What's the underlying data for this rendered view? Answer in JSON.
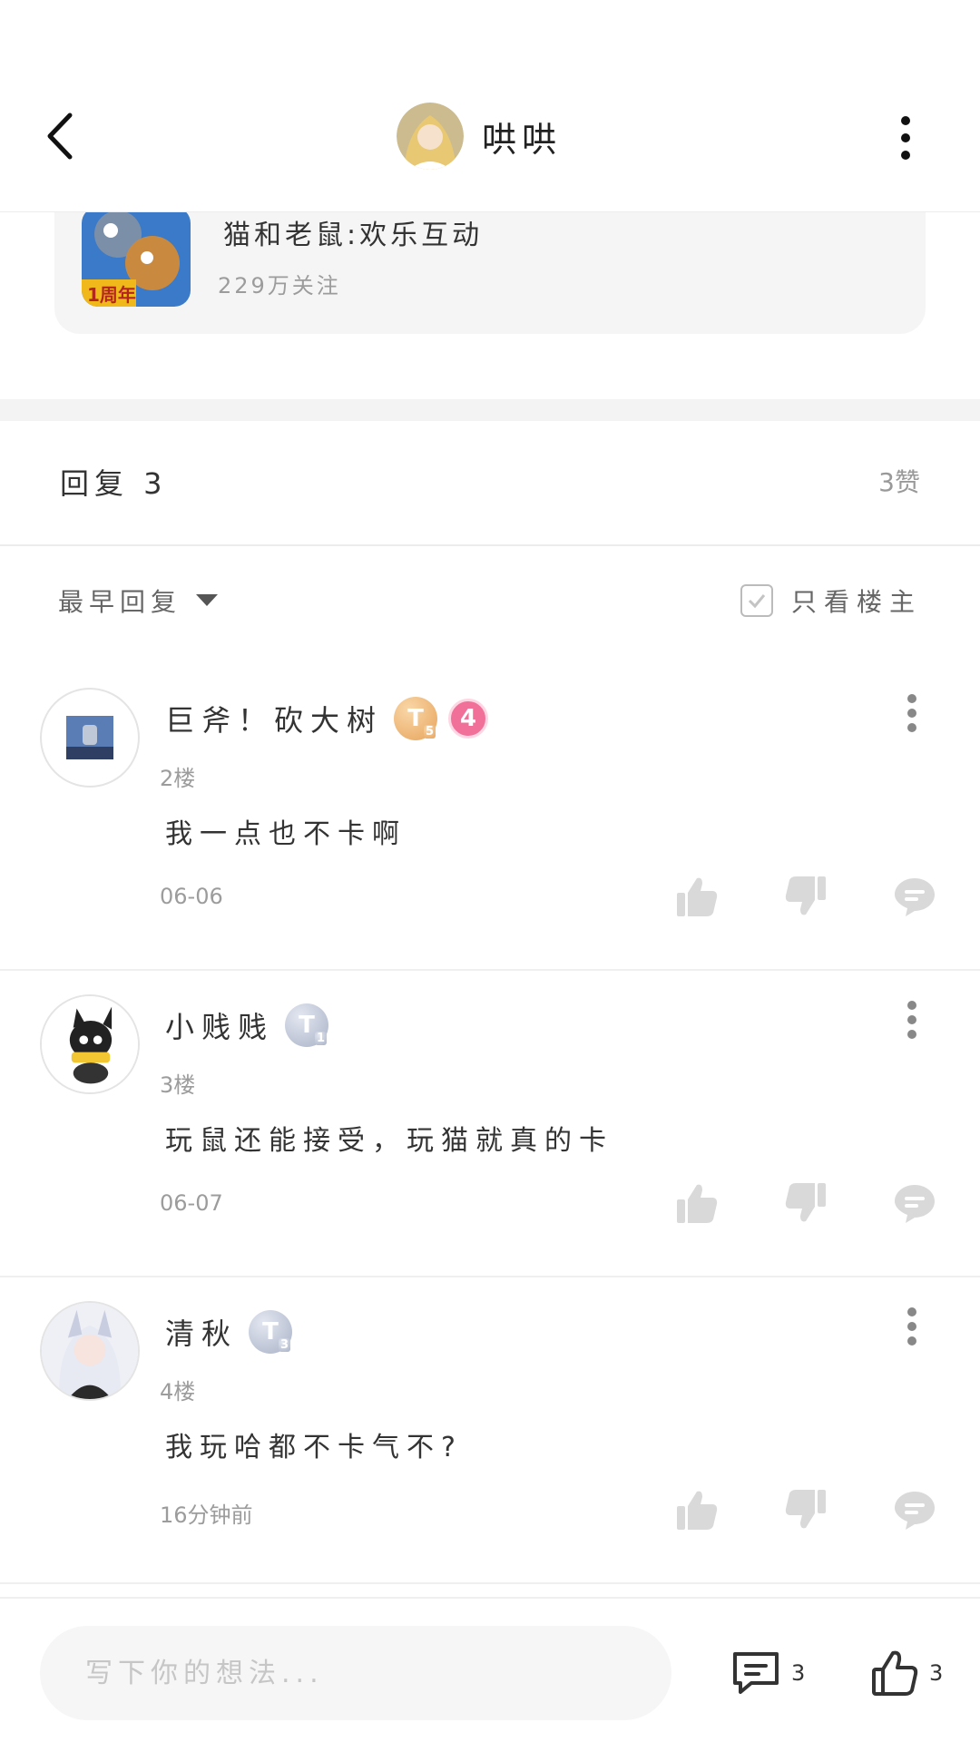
{
  "header": {
    "title": "哄哄",
    "back_icon": "chevron-left-icon",
    "more_icon": "more-vertical-icon"
  },
  "game": {
    "name": "猫和老鼠:欢乐互动",
    "followers": "229万关注",
    "icon_badge": "1周年"
  },
  "replies": {
    "title": "回复 3",
    "likes": "3赞"
  },
  "filters": {
    "sort_label": "最早回复",
    "owner_only_label": "只看楼主"
  },
  "comments": [
    {
      "name": "巨斧！砍大树",
      "level": "T",
      "level_sub": "5",
      "extra_badge": "4",
      "floor": "2楼",
      "text": "我一点也不卡啊",
      "time": "06-06"
    },
    {
      "name": "小贱贱",
      "level": "T",
      "level_sub": "1",
      "floor": "3楼",
      "text": "玩鼠还能接受，玩猫就真的卡",
      "time": "06-07"
    },
    {
      "name": "清秋",
      "level": "T",
      "level_sub": "3",
      "floor": "4楼",
      "text": "我玩哈都不卡气不?",
      "time": "16分钟前"
    }
  ],
  "bottom": {
    "placeholder": "写下你的想法...",
    "comment_count": "3",
    "like_count": "3"
  },
  "colors": {
    "badge_gold": "#e7a35a",
    "badge_silver": "#a9b2c6",
    "badge_pink": "#f0709a",
    "muted_text": "#9c9c9c",
    "icon_gray": "#d9d9d9"
  }
}
